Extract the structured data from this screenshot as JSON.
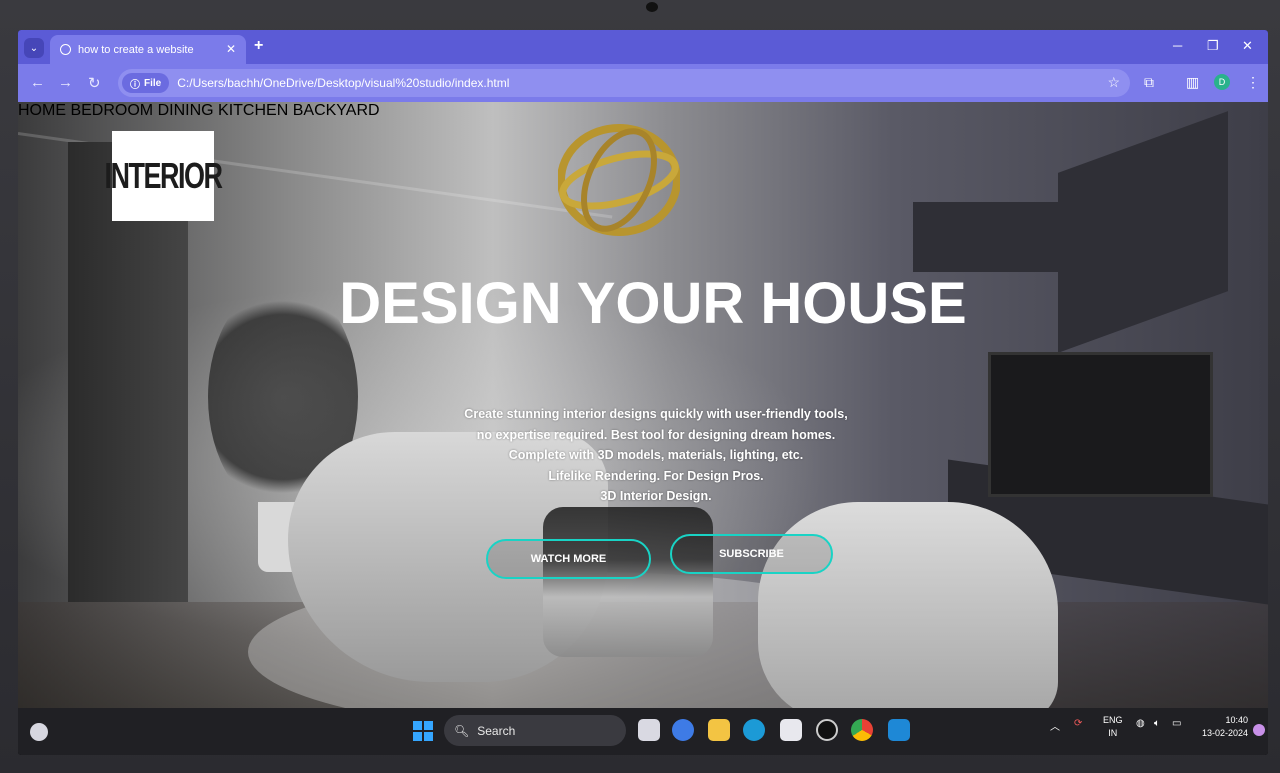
{
  "browser": {
    "tab_title": "how to create a website",
    "new_tab_symbol": "+",
    "file_chip": "File",
    "url": "C:/Users/bachh/OneDrive/Desktop/visual%20studio/index.html",
    "profile_initial": "D"
  },
  "site": {
    "logo_text": "INTERIOR",
    "nav": [
      "HOME",
      "BEDROOM",
      "DINING",
      "KITCHEN",
      "BACKYARD"
    ],
    "hero_title": "DESIGN YOUR HOUSE",
    "hero_lines": [
      "Create stunning interior designs quickly with user-friendly tools,",
      "no expertise required. Best tool for designing dream homes.",
      "Complete with 3D models, materials, lighting, etc.",
      "Lifelike Rendering. For Design Pros.",
      "3D Interior Design."
    ],
    "buttons": {
      "watch_more": "WATCH MORE",
      "subscribe": "SUBSCRIBE"
    },
    "accent_color": "#19d3c5"
  },
  "taskbar": {
    "search_label": "Search",
    "language": [
      "ENG",
      "IN"
    ],
    "time": "10:40",
    "date": "13-02-2024"
  }
}
